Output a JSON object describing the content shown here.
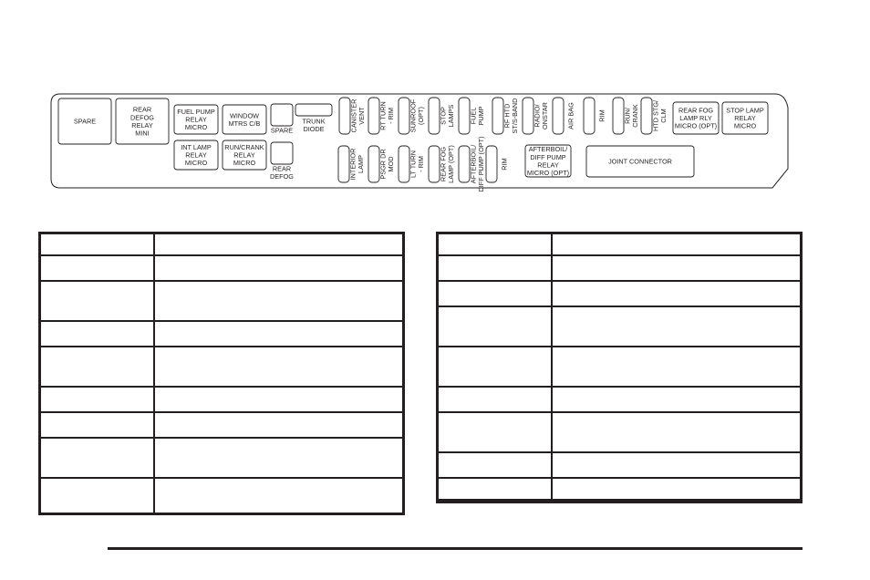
{
  "fuse_block": {
    "large_relays": [
      {
        "id": "spare-large",
        "lines": [
          "SPARE"
        ]
      },
      {
        "id": "rear-defog-relay-mini",
        "lines": [
          "REAR",
          "DEFOG",
          "RELAY",
          "MINI"
        ]
      }
    ],
    "micro_relays_left": [
      {
        "id": "fuel-pump-relay",
        "lines": [
          "FUEL PUMP",
          "RELAY",
          "MICRO"
        ]
      },
      {
        "id": "window-mtrs-cb",
        "lines": [
          "WINDOW",
          "MTRS C/B"
        ]
      },
      {
        "id": "int-lamp-relay",
        "lines": [
          "INT LAMP",
          "RELAY",
          "MICRO"
        ]
      },
      {
        "id": "run-crank-relay",
        "lines": [
          "RUN/CRANK",
          "RELAY",
          "MICRO"
        ]
      }
    ],
    "small_fuses": [
      {
        "id": "spare-small",
        "lines": [
          "SPARE"
        ]
      },
      {
        "id": "trunk-diode",
        "lines": [
          "TRUNK",
          "DIODE"
        ]
      },
      {
        "id": "rear-defog",
        "lines": [
          "REAR",
          "DEFOG"
        ]
      }
    ],
    "vertical_fuses_top": [
      {
        "id": "canister-vent",
        "lines": [
          "CANISTER",
          "VENT"
        ]
      },
      {
        "id": "rt-turn-rim",
        "lines": [
          "RT TURN",
          "- RIM"
        ]
      },
      {
        "id": "sunroof",
        "lines": [
          "SUNROOF",
          "(OPT)"
        ]
      },
      {
        "id": "stop-lamps",
        "lines": [
          "STOP",
          "LAMPS"
        ]
      },
      {
        "id": "fuel-pump",
        "lines": [
          "FUEL",
          "PUMP"
        ]
      },
      {
        "id": "rf-htd-sts-band",
        "lines": [
          "RF HTD",
          "ST/S-BAND"
        ]
      },
      {
        "id": "radio-onstar",
        "lines": [
          "RADIO/",
          "ONSTAR"
        ]
      },
      {
        "id": "air-bag",
        "lines": [
          "AIR BAG"
        ]
      },
      {
        "id": "rim-top",
        "lines": [
          "RIM"
        ]
      },
      {
        "id": "run-crank",
        "lines": [
          "RUN/",
          "CRANK"
        ]
      },
      {
        "id": "htd-stg-clm",
        "lines": [
          "HTD STG/",
          "CLM"
        ]
      }
    ],
    "vertical_fuses_bottom": [
      {
        "id": "interior-lamp",
        "lines": [
          "INTERIOR",
          "LAMP"
        ]
      },
      {
        "id": "psgr-dr-mod",
        "lines": [
          "PSGR DR",
          "MOD"
        ]
      },
      {
        "id": "lt-turn-rim",
        "lines": [
          "LT TURN",
          "- RIM"
        ]
      },
      {
        "id": "rear-fog-lamp",
        "lines": [
          "REAR FOG",
          "LAMP (OPT)"
        ]
      },
      {
        "id": "afterboil-diff-pump",
        "lines": [
          "AFTERBOIL/",
          "DIFF PUMP (OPT)"
        ]
      },
      {
        "id": "rim-bottom",
        "lines": [
          "RIM"
        ]
      }
    ],
    "micro_relays_right": [
      {
        "id": "afterboil-diff-pump-relay",
        "lines": [
          "AFTERBOIL/",
          "DIFF PUMP",
          "RELAY",
          "MICRO (OPT)"
        ]
      },
      {
        "id": "rear-fog-lamp-rly",
        "lines": [
          "REAR FOG",
          "LAMP RLY",
          "MICRO (OPT)"
        ]
      },
      {
        "id": "stop-lamp-relay",
        "lines": [
          "STOP LAMP",
          "RELAY",
          "MICRO"
        ]
      }
    ],
    "joint_connector": {
      "id": "joint-connector",
      "lines": [
        "JOINT CONNECTOR"
      ]
    }
  },
  "tables": {
    "left": {
      "header": [
        "",
        ""
      ],
      "rows": [
        [
          "",
          ""
        ],
        [
          "",
          ""
        ],
        [
          "",
          ""
        ],
        [
          "",
          ""
        ],
        [
          "",
          ""
        ],
        [
          "",
          ""
        ],
        [
          "",
          ""
        ],
        [
          "",
          ""
        ]
      ]
    },
    "right": {
      "header": [
        "",
        ""
      ],
      "rows": [
        [
          "",
          ""
        ],
        [
          "",
          ""
        ],
        [
          "",
          ""
        ],
        [
          "",
          ""
        ],
        [
          "",
          ""
        ],
        [
          "",
          ""
        ],
        [
          "",
          ""
        ],
        [
          "",
          ""
        ],
        [
          "",
          ""
        ]
      ]
    }
  }
}
